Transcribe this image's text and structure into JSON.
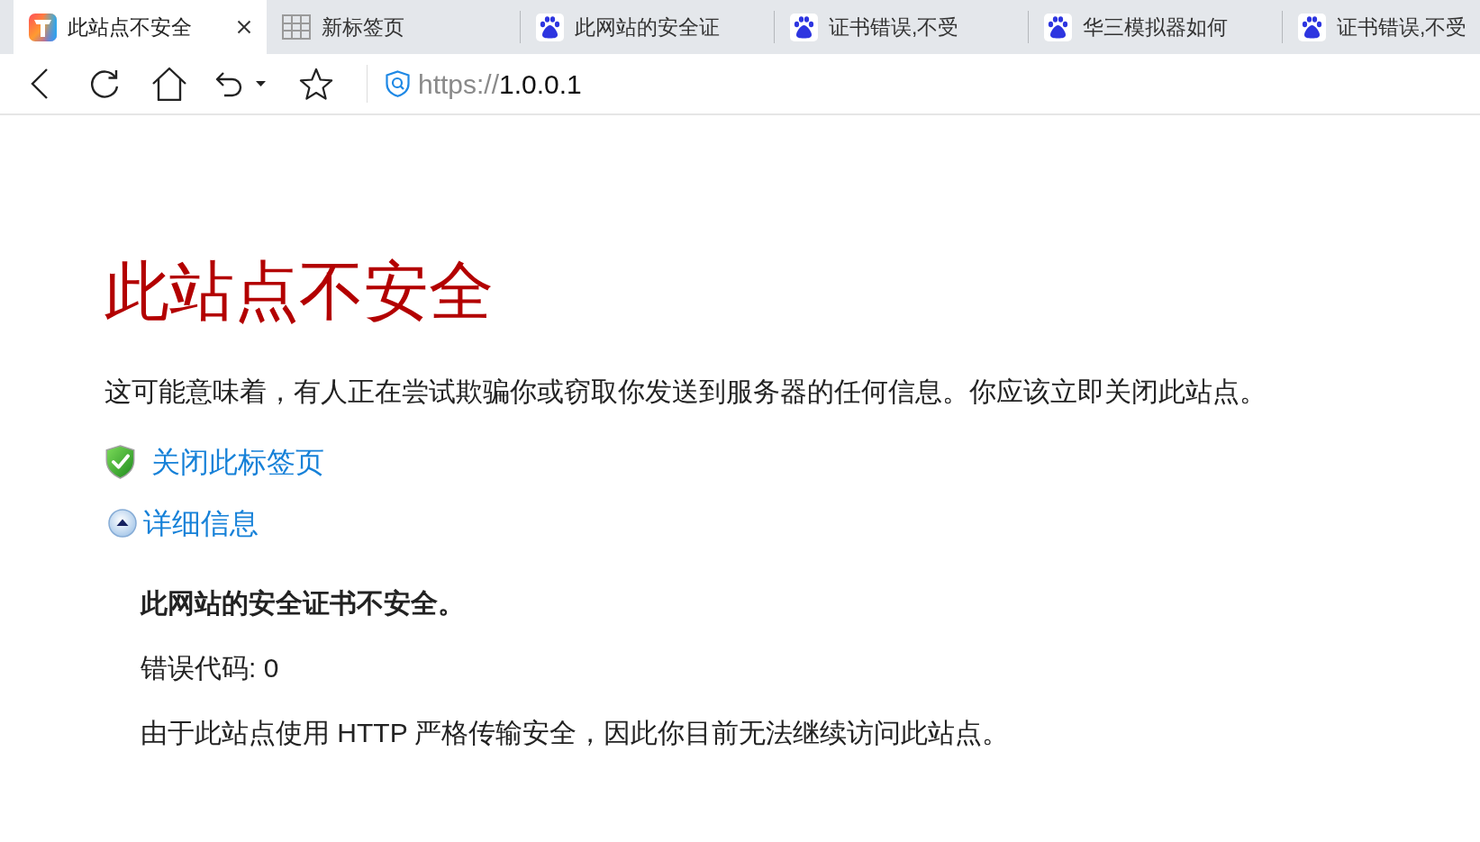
{
  "tabs": [
    {
      "title": "此站点不安全",
      "kind": "app",
      "selected": true
    },
    {
      "title": "新标签页",
      "kind": "new_tab",
      "selected": false
    },
    {
      "title": "此网站的安全证",
      "kind": "site",
      "selected": false
    },
    {
      "title": "证书错误,不受",
      "kind": "site",
      "selected": false
    },
    {
      "title": "华三模拟器如何",
      "kind": "site",
      "selected": false
    },
    {
      "title": "证书错误,不受",
      "kind": "site",
      "selected": false
    }
  ],
  "address_bar": {
    "scheme": "https://",
    "host": "1.0.0.1"
  },
  "page": {
    "title": "此站点不安全",
    "message": "这可能意味着，有人正在尝试欺骗你或窃取你发送到服务器的任何信息。你应该立即关闭此站点。",
    "close_link": {
      "text": "关闭此标签页"
    },
    "details_link": {
      "text": "详细信息",
      "expanded": true
    },
    "details": [
      {
        "kind": "heading",
        "text": "此网站的安全证书不安全。"
      },
      {
        "kind": "text",
        "text": "错误代码: 0"
      },
      {
        "kind": "text",
        "text": "由于此站点使用 HTTP 严格传输安全，因此你目前无法继续访问此站点。"
      }
    ]
  }
}
